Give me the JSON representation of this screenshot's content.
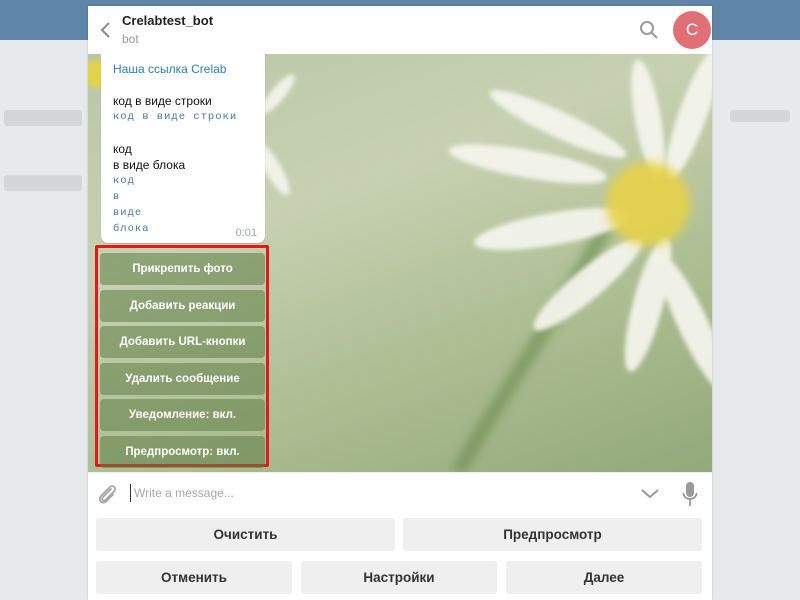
{
  "header": {
    "title": "Crelabtest_bot",
    "status": "bot",
    "avatar_letter": "C",
    "avatar_color": "#e17076"
  },
  "message": {
    "link_text": "Наша ссылка Crelab",
    "inline_label": "код в виде строки",
    "inline_code": "код в виде строки",
    "block_label_1": "код",
    "block_label_2": "в виде блока",
    "block_code_lines": [
      "код",
      "в",
      "виде",
      "блока"
    ],
    "time": "0:01"
  },
  "inline_keyboard": [
    "Прикрепить фото",
    "Добавить реакции",
    "Добавить URL-кнопки",
    "Удалить сообщение",
    "Уведомление: вкл.",
    "Предпросмотр: вкл."
  ],
  "composer": {
    "placeholder": "Write a message..."
  },
  "reply_keyboard": {
    "row1": [
      "Очистить",
      "Предпросмотр"
    ],
    "row2": [
      "Отменить",
      "Настройки",
      "Далее"
    ]
  },
  "colors": {
    "highlight": "#e01919",
    "link": "#2e7eb5"
  }
}
